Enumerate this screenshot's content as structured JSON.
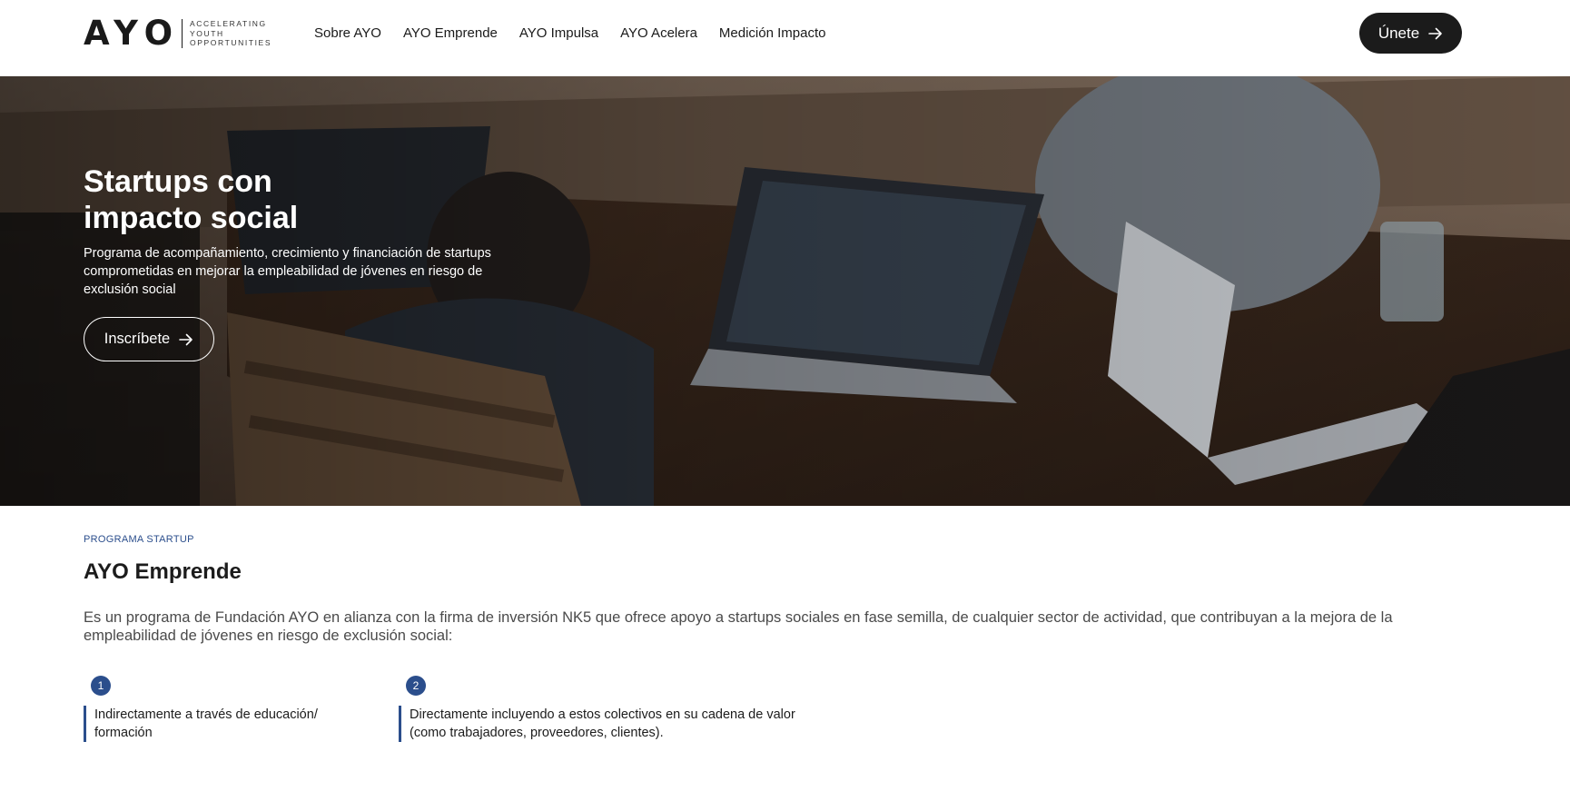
{
  "header": {
    "logo_mark": "AYO",
    "logo_tagline": [
      "ACCELERATING",
      "YOUTH",
      "OPPORTUNITIES"
    ],
    "nav": [
      "Sobre AYO",
      "AYO Emprende",
      "AYO Impulsa",
      "AYO Acelera",
      "Medición Impacto"
    ],
    "join_label": "Únete"
  },
  "hero": {
    "title_line1": "Startups con",
    "title_line2": "impacto social",
    "subtitle": "Programa de acompañamiento, crecimiento y financiación de startups comprometidas en mejorar la empleabilidad de jóvenes en riesgo de exclusión social",
    "cta_label": "Inscríbete"
  },
  "section": {
    "eyebrow": "PROGRAMA STARTUP",
    "title": "AYO Emprende",
    "intro": "Es un programa de Fundación AYO en alianza con la firma de inversión NK5 que ofrece apoyo a startups sociales en fase semilla, de cualquier sector de actividad, que contribuyan a la mejora de la empleabilidad de jóvenes en riesgo de exclusión social:",
    "steps": [
      {
        "number": "1",
        "text": "Indirectamente a través de educación/ formación"
      },
      {
        "number": "2",
        "text": "Directamente incluyendo a estos colectivos en su cadena de valor (como trabajadores, proveedores, clientes)."
      }
    ]
  },
  "colors": {
    "accent": "#2b4e8c",
    "dark_button": "#1b1b1b",
    "text": "#1c1c1c"
  },
  "icons": {
    "join_arrow": "arrow-right-icon",
    "cta_arrow": "arrow-right-icon"
  }
}
